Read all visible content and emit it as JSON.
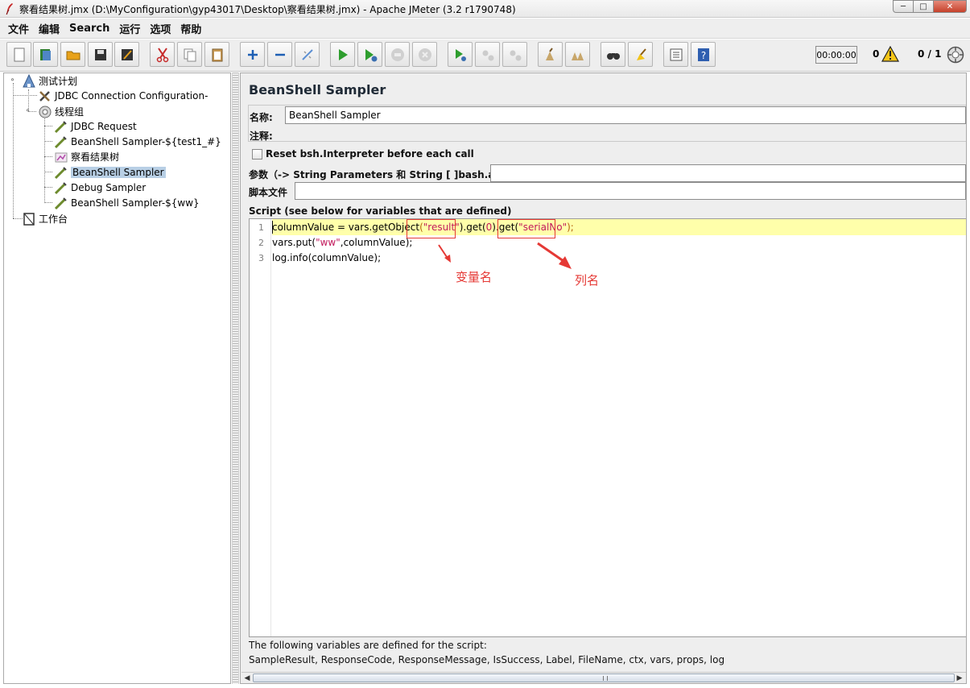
{
  "window": {
    "title": "察看结果树.jmx (D:\\MyConfiguration\\gyp43017\\Desktop\\察看结果树.jmx) - Apache JMeter (3.2 r1790748)",
    "min_label": "─",
    "max_label": "□",
    "close_label": "✕"
  },
  "menu": [
    "文件",
    "编辑",
    "Search",
    "运行",
    "选项",
    "帮助"
  ],
  "toolbar": {
    "timer": "00:00:00",
    "error_count": "0",
    "thread_count": "0 / 1"
  },
  "tree": {
    "nodes": [
      {
        "label": "测试计划",
        "icon": "test-plan-icon"
      },
      {
        "label": "JDBC Connection Configuration-",
        "icon": "config-element-icon"
      },
      {
        "label": "线程组",
        "icon": "thread-group-icon"
      },
      {
        "label": "JDBC Request",
        "icon": "sampler-icon"
      },
      {
        "label": "BeanShell Sampler-${test1_#}",
        "icon": "sampler-icon"
      },
      {
        "label": "察看结果树",
        "icon": "listener-icon"
      },
      {
        "label": "BeanShell Sampler",
        "icon": "sampler-icon"
      },
      {
        "label": "Debug Sampler",
        "icon": "sampler-icon"
      },
      {
        "label": "BeanShell Sampler-${ww}",
        "icon": "sampler-icon"
      },
      {
        "label": "工作台",
        "icon": "workbench-icon"
      }
    ],
    "selected": "BeanShell Sampler"
  },
  "panel": {
    "title": "BeanShell Sampler",
    "name_label": "名称:",
    "name_value": "BeanShell Sampler",
    "comment_label": "注释:",
    "reset_label": "Reset bsh.Interpreter before each call",
    "params_label": "参数（-> String Parameters 和 String [ ]bash.args）",
    "script_file_label": "脚本文件",
    "script_header": "Script (see below for variables that are defined)",
    "script_lines": {
      "n1": "1",
      "n2": "2",
      "n3": "3",
      "l1": {
        "a": "columnValue = vars.getObject",
        "b": "(",
        "c": "\"result\"",
        "d": ").get(",
        "e": "0",
        "f": ").get(",
        "g": "\"serialNo\"",
        "h": ");"
      },
      "l2": {
        "a": "vars.put(",
        "b": "\"ww\"",
        "c": ",columnValue);"
      },
      "l3": {
        "a": "log.info(columnValue);"
      }
    },
    "annotations": {
      "var_name": "变量名",
      "col_name": "列名"
    },
    "footer_line1": "The following variables are defined for the script:",
    "footer_line2": "SampleResult, ResponseCode, ResponseMessage, IsSuccess, Label, FileName, ctx, vars, props, log"
  },
  "colors": {
    "annotation_red": "#e53935",
    "selection": "#b8cfe5",
    "current_line": "#ffffaa"
  }
}
